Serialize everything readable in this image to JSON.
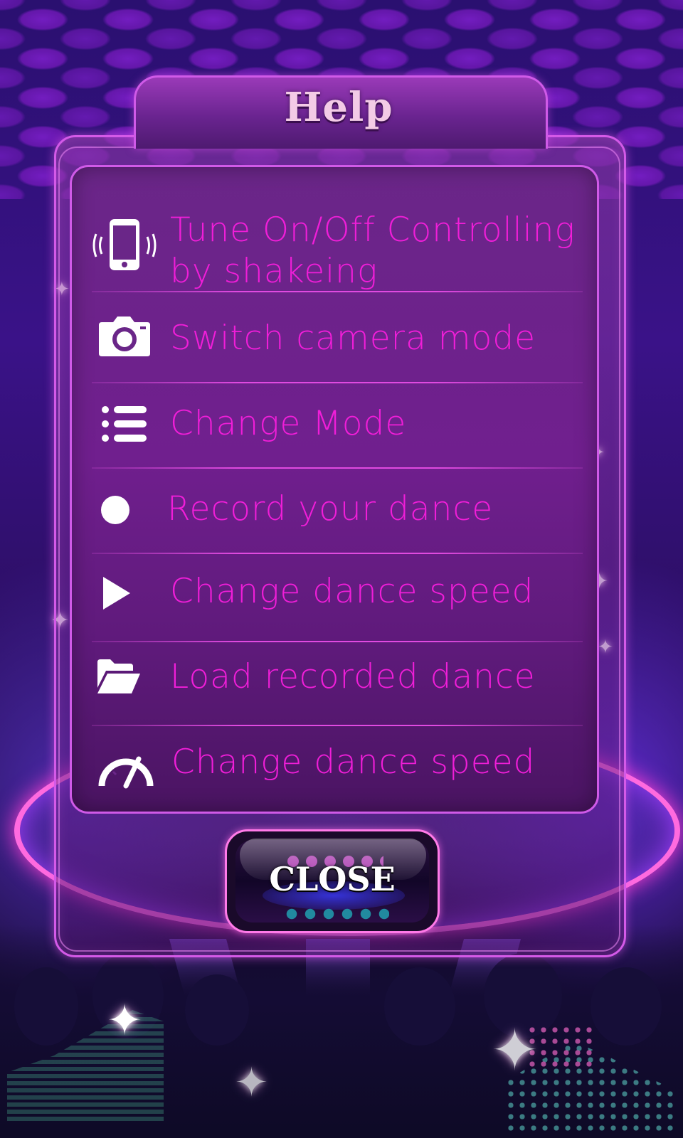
{
  "dialog": {
    "title": "Help",
    "close_label": "CLOSE"
  },
  "help_items": [
    {
      "icon": "shake-phone-icon",
      "label_line1": "Tune On/Off Controlling",
      "label_line2": "by shakeing"
    },
    {
      "icon": "camera-icon",
      "label": "Switch camera mode"
    },
    {
      "icon": "list-icon",
      "label": "Change Mode"
    },
    {
      "icon": "record-icon",
      "label": "Record your dance"
    },
    {
      "icon": "play-icon",
      "label": "Change dance speed"
    },
    {
      "icon": "folder-open-icon",
      "label": "Load recorded dance"
    },
    {
      "icon": "speedometer-icon",
      "label": "Change dance speed"
    }
  ],
  "colors": {
    "label_text": "#f01ed8",
    "accent_border": "#d05ae8",
    "title_text": "#f3cbe6"
  }
}
